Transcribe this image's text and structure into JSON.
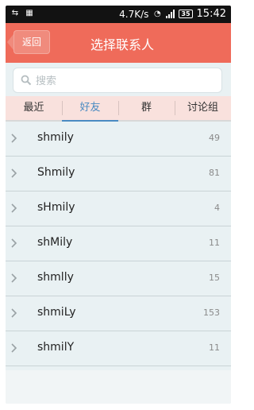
{
  "status_bar": {
    "network_speed": "4.7K/s",
    "battery": "35",
    "time": "15:42"
  },
  "header": {
    "back_label": "返回",
    "title": "选择联系人"
  },
  "search": {
    "placeholder": "搜索"
  },
  "tabs": [
    {
      "label": "最近"
    },
    {
      "label": "好友"
    },
    {
      "label": "群"
    },
    {
      "label": "讨论组"
    }
  ],
  "active_tab": "好友",
  "contacts": [
    {
      "name": "shmily",
      "count": "49"
    },
    {
      "name": "Shmily",
      "count": "81"
    },
    {
      "name": "sHmily",
      "count": "4"
    },
    {
      "name": "shMily",
      "count": "11"
    },
    {
      "name": "shmlly",
      "count": "15"
    },
    {
      "name": "shmiLy",
      "count": "153"
    },
    {
      "name": "shmilY",
      "count": "11"
    }
  ],
  "colors": {
    "header_bg": "#ef6b5a",
    "tab_active": "#4a8bc2",
    "list_bg": "#e9f1f3"
  }
}
